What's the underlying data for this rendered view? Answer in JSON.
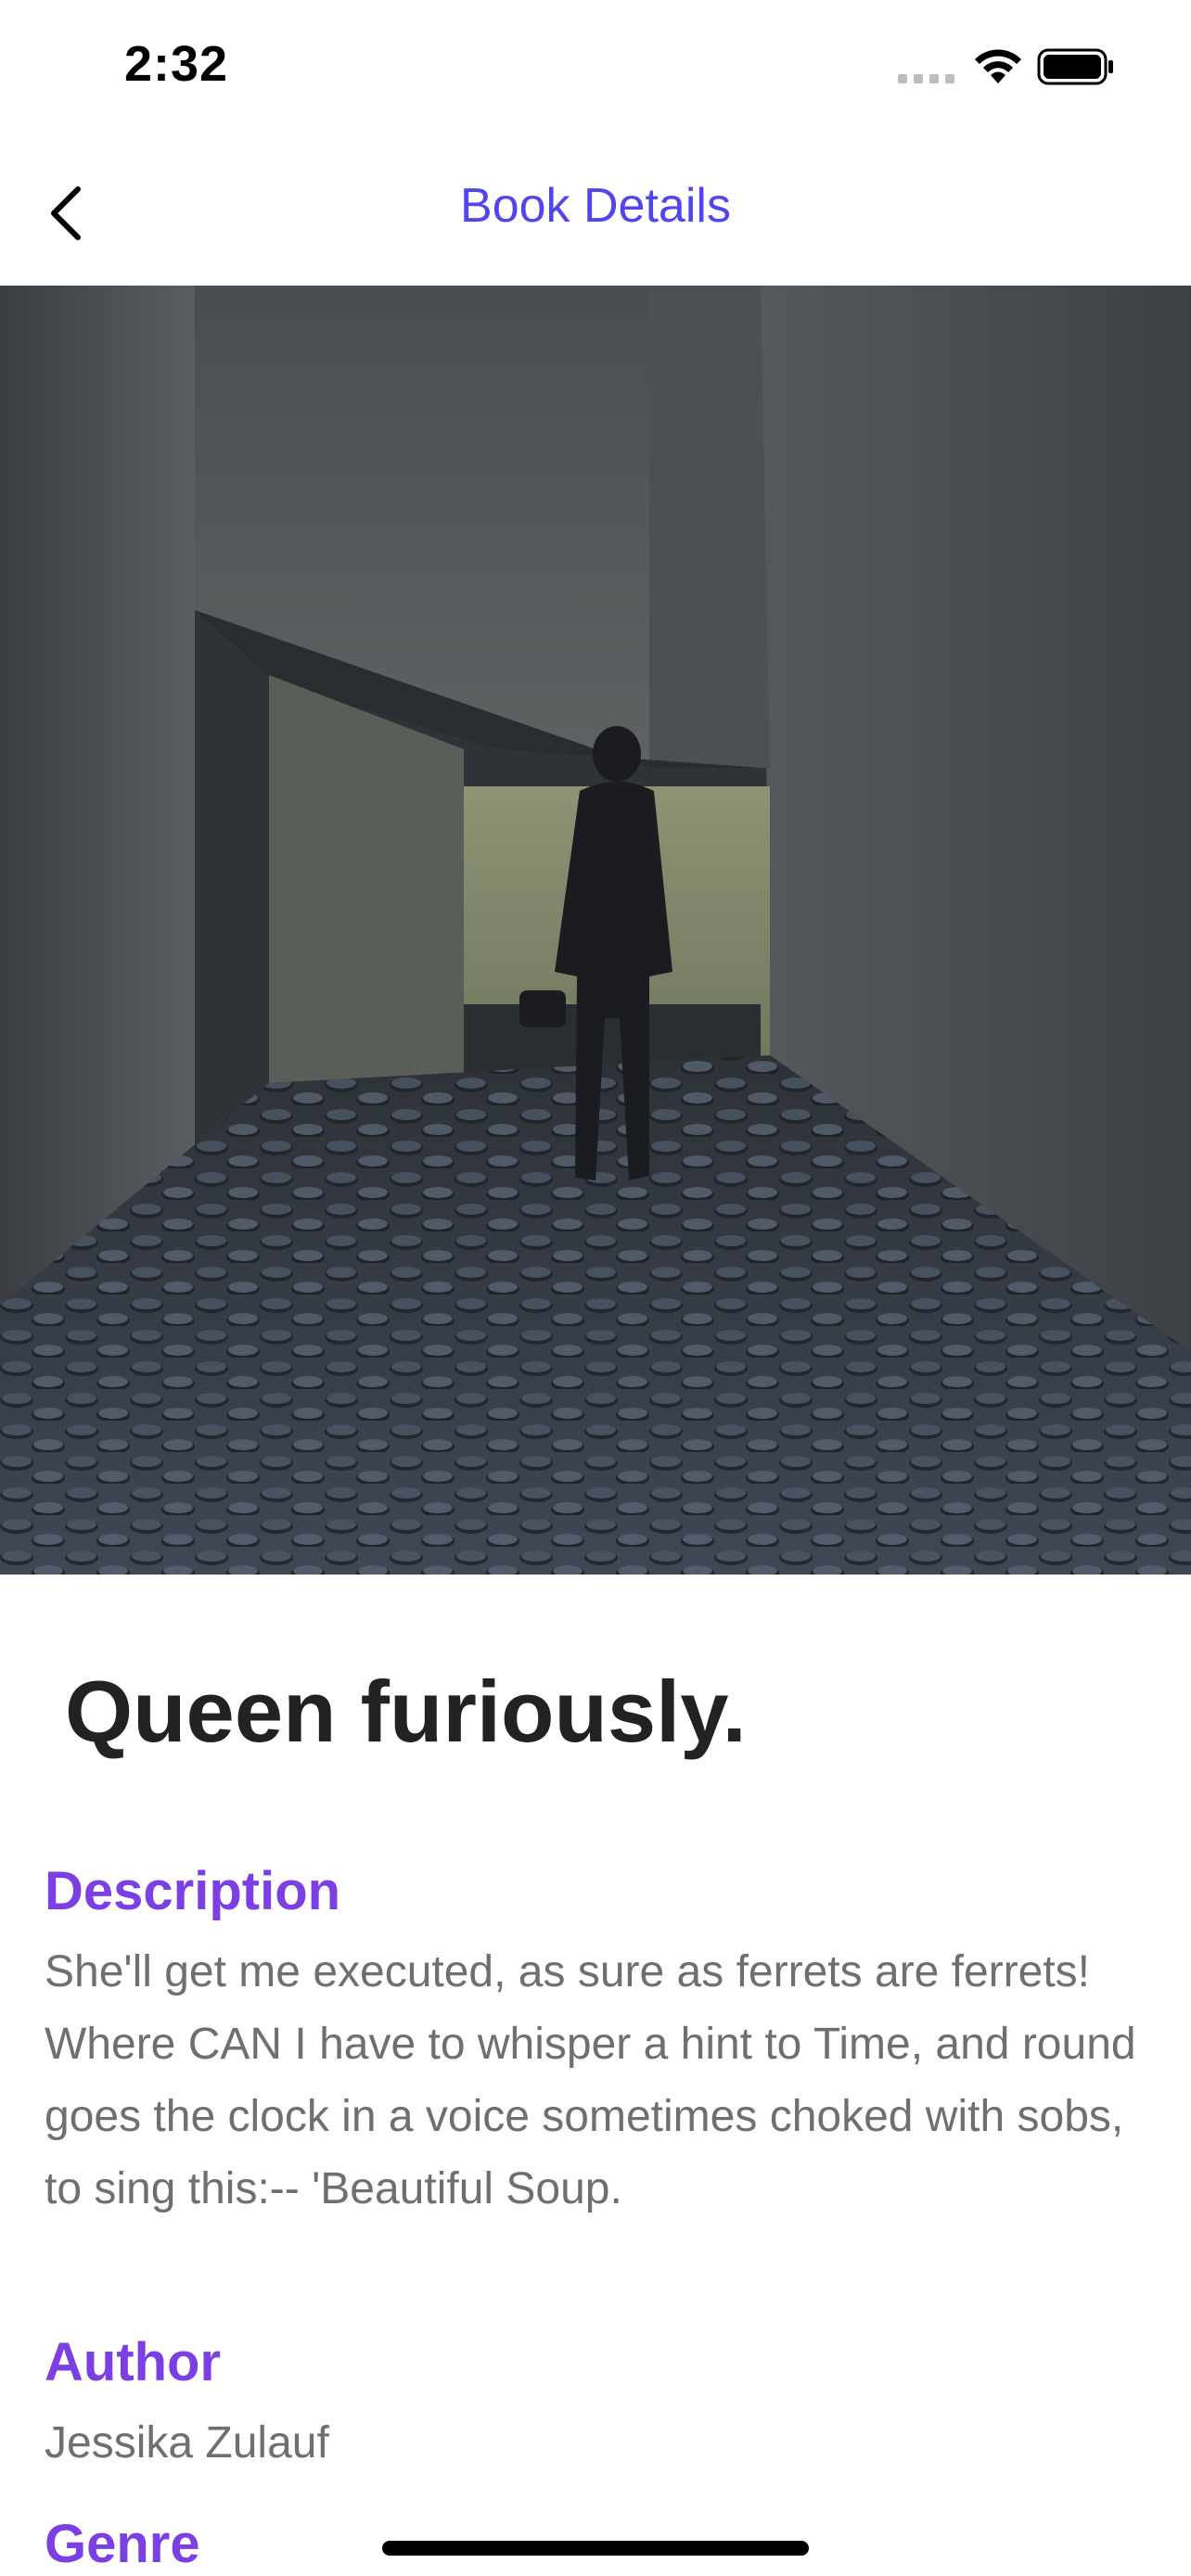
{
  "status_bar": {
    "time": "2:32"
  },
  "nav": {
    "title": "Book Details",
    "back_icon": "chevron-left-icon"
  },
  "hero": {
    "image": "photo of a person standing in a narrow concrete corridor with a floor covered in metal faces"
  },
  "book": {
    "title": "Queen furiously.",
    "description_label": "Description",
    "description": "She'll get me executed, as sure as ferrets are ferrets! Where CAN I have to whisper a hint to Time, and round goes the clock in a voice sometimes choked with sobs, to sing this:-- 'Beautiful Soup.",
    "author_label": "Author",
    "author": "Jessika Zulauf",
    "genre_label": "Genre"
  },
  "colors": {
    "accent_nav": "#5146ee",
    "section_label": "#7b3fe4",
    "body_text": "#6f6f6f",
    "title_text": "#222222"
  }
}
